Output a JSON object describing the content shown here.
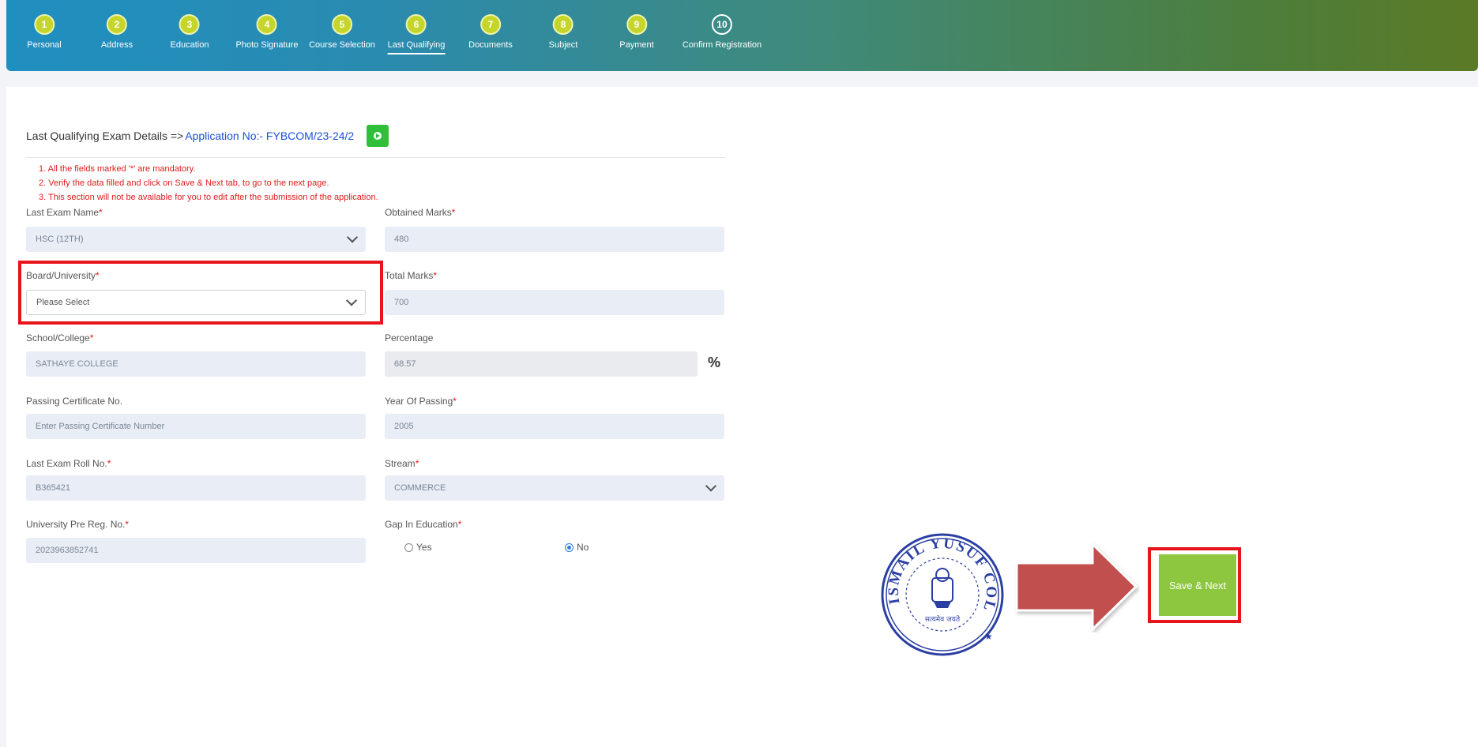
{
  "steps": [
    {
      "num": "1",
      "label": "Personal"
    },
    {
      "num": "2",
      "label": "Address"
    },
    {
      "num": "3",
      "label": "Education"
    },
    {
      "num": "4",
      "label": "Photo Signature"
    },
    {
      "num": "5",
      "label": "Course Selection"
    },
    {
      "num": "6",
      "label": "Last Qualifying"
    },
    {
      "num": "7",
      "label": "Documents"
    },
    {
      "num": "8",
      "label": "Subject"
    },
    {
      "num": "9",
      "label": "Payment"
    },
    {
      "num": "10",
      "label": "Confirm Registration"
    }
  ],
  "active_step": "Last Qualifying",
  "header": {
    "title": "Last Qualifying Exam Details =>",
    "application": "Application No:- FYBCOM/23-24/2"
  },
  "notes": [
    "1. All the fields marked '*' are mandatory.",
    "2. Verify the data filled and click on Save & Next tab, to go to the next page.",
    "3. This section will not be available for you to edit after the submission of the application."
  ],
  "form": {
    "last_exam_name": {
      "label": "Last Exam Name",
      "value": "HSC (12TH)"
    },
    "obtained_marks": {
      "label": "Obtained Marks",
      "value": "480"
    },
    "board_university": {
      "label": "Board/University",
      "value": "Please Select"
    },
    "total_marks": {
      "label": "Total Marks",
      "value": "700"
    },
    "school_college": {
      "label": "School/College",
      "value": "SATHAYE COLLEGE"
    },
    "percentage": {
      "label": "Percentage",
      "value": "68.57",
      "suffix": "%"
    },
    "passing_cert": {
      "label": "Passing Certificate No.",
      "placeholder": "Enter Passing Certificate Number"
    },
    "year_of_passing": {
      "label": "Year Of Passing",
      "value": "2005"
    },
    "roll_no": {
      "label": "Last Exam Roll No.",
      "value": "B365421"
    },
    "stream": {
      "label": "Stream",
      "value": "COMMERCE"
    },
    "pre_reg": {
      "label": "University Pre Reg. No.",
      "value": "2023963852741"
    },
    "gap": {
      "label": "Gap In Education",
      "options": [
        "Yes",
        "No"
      ],
      "selected": "No"
    }
  },
  "required_mark": "*",
  "seal": {
    "text": "ISMAIL YUSUF COLLEGE",
    "motto": "सत्यमेव जयते"
  },
  "save_button": "Save & Next",
  "colors": {
    "accent_green": "#8dc63f",
    "highlight_red": "#e8141c",
    "step_circle": "#c5d52b"
  }
}
